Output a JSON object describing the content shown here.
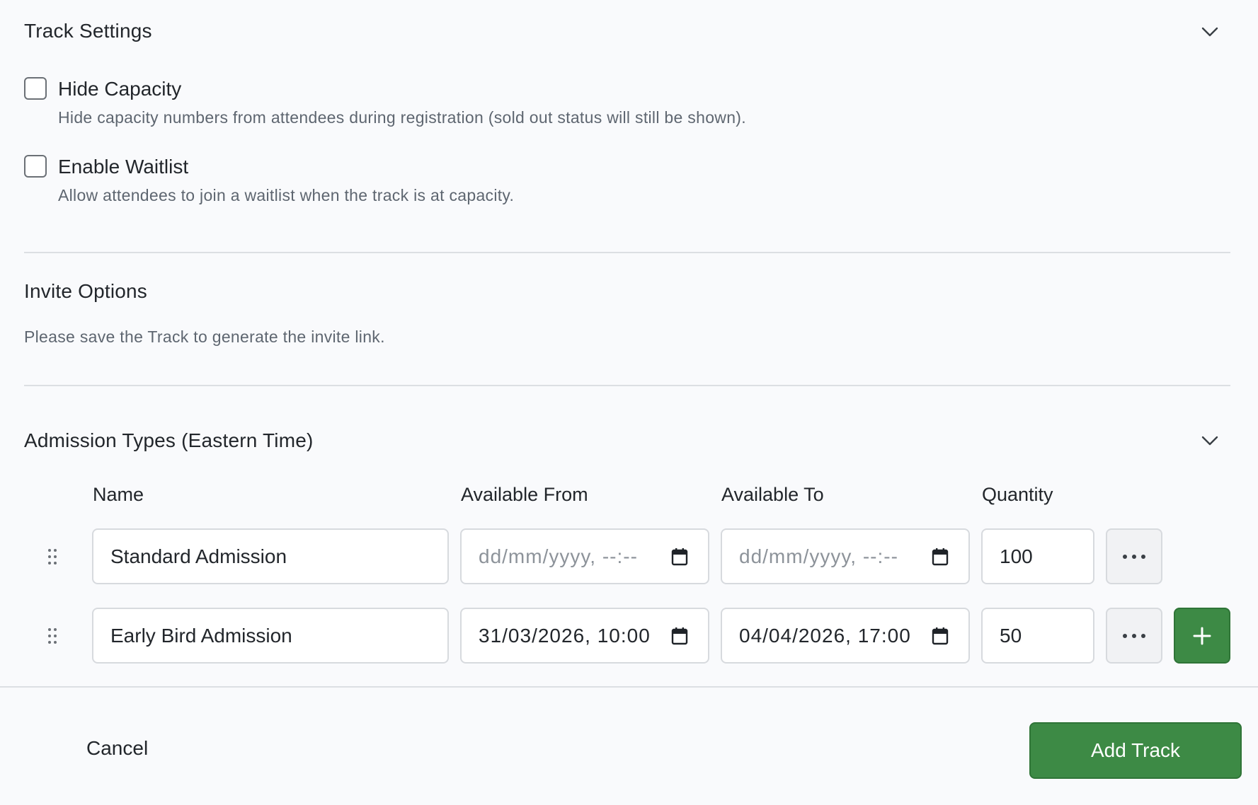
{
  "track_settings": {
    "title": "Track Settings",
    "options": [
      {
        "label": "Hide Capacity",
        "description": "Hide capacity numbers from attendees during registration (sold out status will still be shown).",
        "checked": false
      },
      {
        "label": "Enable Waitlist",
        "description": "Allow attendees to join a waitlist when the track is at capacity.",
        "checked": false
      }
    ]
  },
  "invite_options": {
    "title": "Invite Options",
    "message": "Please save the Track to generate the invite link."
  },
  "admission_types": {
    "title": "Admission Types (Eastern Time)",
    "columns": {
      "name": "Name",
      "available_from": "Available From",
      "available_to": "Available To",
      "quantity": "Quantity"
    },
    "date_placeholder": "dd/mm/yyyy, --:--",
    "rows": [
      {
        "name": "Standard Admission",
        "available_from": "",
        "available_to": "",
        "quantity": "100"
      },
      {
        "name": "Early Bird Admission",
        "available_from": "31/03/2026, 10:00",
        "available_to": "04/04/2026, 17:00",
        "quantity": "50"
      }
    ]
  },
  "footer": {
    "cancel_label": "Cancel",
    "submit_label": "Add Track"
  },
  "colors": {
    "accent_green": "#3d8a45",
    "background": "#f9fafc",
    "border": "#d7dade"
  },
  "icons": {
    "collapse": "chevron-down-icon",
    "drag": "drag-handle-icon",
    "calendar": "calendar-icon",
    "more": "more-horizontal-icon",
    "add": "plus-icon"
  }
}
